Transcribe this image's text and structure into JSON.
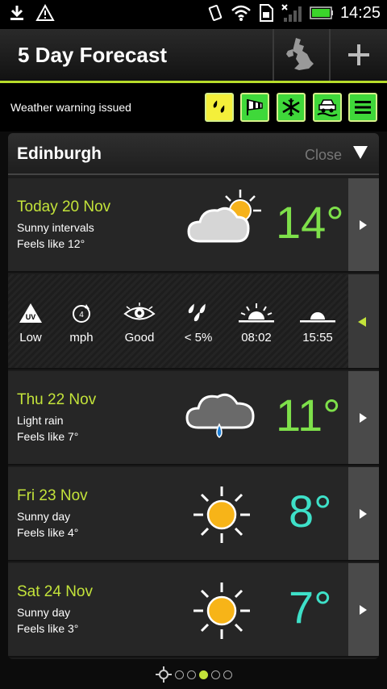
{
  "status_bar": {
    "time": "14:25"
  },
  "header": {
    "title": "5 Day Forecast"
  },
  "warning": {
    "text": "Weather warning issued"
  },
  "card": {
    "city": "Edinburgh",
    "close_label": "Close"
  },
  "today": {
    "date": "Today 20 Nov",
    "desc": "Sunny intervals",
    "feels": "Feels like 12°",
    "temp": "14°"
  },
  "details": {
    "uv": "Low",
    "uv_icon_text": "UV",
    "wind_icon_text": "4",
    "wind": "mph",
    "visibility": "Good",
    "rain": "< 5%",
    "sunrise": "08:02",
    "sunset": "15:55"
  },
  "days": [
    {
      "date": "Thu 22 Nov",
      "desc": "Light rain",
      "feels": "Feels like 7°",
      "temp": "11°"
    },
    {
      "date": "Fri 23 Nov",
      "desc": "Sunny day",
      "feels": "Feels like 4°",
      "temp": "8°"
    },
    {
      "date": "Sat 24 Nov",
      "desc": "Sunny day",
      "feels": "Feels like 3°",
      "temp": "7°"
    }
  ],
  "colors": {
    "accent": "#c3e33a",
    "temp_green": "#7ee04a",
    "temp_cyan": "#3ee0c8"
  }
}
